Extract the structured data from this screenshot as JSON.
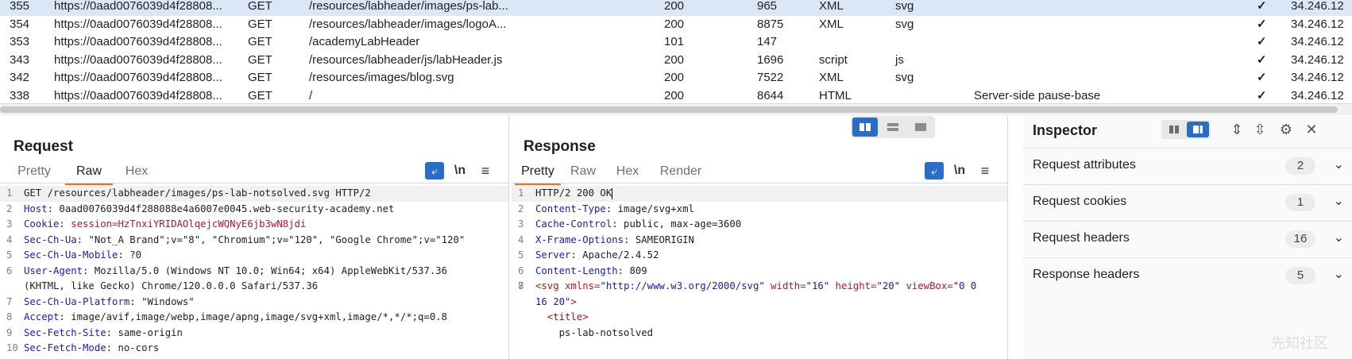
{
  "history": {
    "rows": [
      {
        "num": "355",
        "host": "https://0aad0076039d4f28808...",
        "method": "GET",
        "url": "/resources/labheader/images/ps-lab...",
        "status": "200",
        "length": "965",
        "mime": "XML",
        "ext": "svg",
        "title": "",
        "tls": "✓",
        "ip": "34.246.12",
        "selected": true
      },
      {
        "num": "354",
        "host": "https://0aad0076039d4f28808...",
        "method": "GET",
        "url": "/resources/labheader/images/logoA...",
        "status": "200",
        "length": "8875",
        "mime": "XML",
        "ext": "svg",
        "title": "",
        "tls": "✓",
        "ip": "34.246.12",
        "selected": false
      },
      {
        "num": "353",
        "host": "https://0aad0076039d4f28808...",
        "method": "GET",
        "url": "/academyLabHeader",
        "status": "101",
        "length": "147",
        "mime": "",
        "ext": "",
        "title": "",
        "tls": "✓",
        "ip": "34.246.12",
        "selected": false
      },
      {
        "num": "343",
        "host": "https://0aad0076039d4f28808...",
        "method": "GET",
        "url": "/resources/labheader/js/labHeader.js",
        "status": "200",
        "length": "1696",
        "mime": "script",
        "ext": "js",
        "title": "",
        "tls": "✓",
        "ip": "34.246.12",
        "selected": false
      },
      {
        "num": "342",
        "host": "https://0aad0076039d4f28808...",
        "method": "GET",
        "url": "/resources/images/blog.svg",
        "status": "200",
        "length": "7522",
        "mime": "XML",
        "ext": "svg",
        "title": "",
        "tls": "✓",
        "ip": "34.246.12",
        "selected": false
      },
      {
        "num": "338",
        "host": "https://0aad0076039d4f28808...",
        "method": "GET",
        "url": "/",
        "status": "200",
        "length": "8644",
        "mime": "HTML",
        "ext": "",
        "title": "Server-side pause-base",
        "tls": "✓",
        "ip": "34.246.12",
        "selected": false
      }
    ]
  },
  "request": {
    "title": "Request",
    "tabs": [
      "Pretty",
      "Raw",
      "Hex"
    ],
    "active_tab": "Raw",
    "ln_label": "\\n",
    "lines": [
      {
        "n": "1",
        "parts": [
          {
            "t": "GET /resources/labheader/images/ps-lab-notsolved.svg HTTP/2",
            "c": "txt"
          }
        ]
      },
      {
        "n": "2",
        "parts": [
          {
            "t": "Host",
            "c": "hk"
          },
          {
            "t": ": 0aad0076039d4f288088e4a6007e0045.web-security-academy.net",
            "c": "hv"
          }
        ]
      },
      {
        "n": "3",
        "parts": [
          {
            "t": "Cookie",
            "c": "hk"
          },
          {
            "t": ": ",
            "c": "hv"
          },
          {
            "t": "session=HzTnxiYRIDAOlqejcWQNyE6jb3wN8jdi",
            "c": "ck"
          }
        ]
      },
      {
        "n": "4",
        "parts": [
          {
            "t": "Sec-Ch-Ua",
            "c": "hk"
          },
          {
            "t": ": \"Not_A Brand\";v=\"8\", \"Chromium\";v=\"120\", \"Google Chrome\";v=\"120\"",
            "c": "hv"
          }
        ]
      },
      {
        "n": "5",
        "parts": [
          {
            "t": "Sec-Ch-Ua-Mobile",
            "c": "hk"
          },
          {
            "t": ": ?0",
            "c": "hv"
          }
        ]
      },
      {
        "n": "6",
        "parts": [
          {
            "t": "User-Agent",
            "c": "hk"
          },
          {
            "t": ": Mozilla/5.0 (Windows NT 10.0; Win64; x64) AppleWebKit/537.36",
            "c": "hv"
          }
        ]
      },
      {
        "n": "",
        "parts": [
          {
            "t": "(KHTML, like Gecko) Chrome/120.0.0.0 Safari/537.36",
            "c": "hv"
          }
        ]
      },
      {
        "n": "7",
        "parts": [
          {
            "t": "Sec-Ch-Ua-Platform",
            "c": "hk"
          },
          {
            "t": ": \"Windows\"",
            "c": "hv"
          }
        ]
      },
      {
        "n": "8",
        "parts": [
          {
            "t": "Accept",
            "c": "hk"
          },
          {
            "t": ": image/avif,image/webp,image/apng,image/svg+xml,image/*,*/*;q=0.8",
            "c": "hv"
          }
        ]
      },
      {
        "n": "9",
        "parts": [
          {
            "t": "Sec-Fetch-Site",
            "c": "hk"
          },
          {
            "t": ": same-origin",
            "c": "hv"
          }
        ]
      },
      {
        "n": "10",
        "parts": [
          {
            "t": "Sec-Fetch-Mode",
            "c": "hk"
          },
          {
            "t": ": no-cors",
            "c": "hv"
          }
        ]
      }
    ]
  },
  "response": {
    "title": "Response",
    "tabs": [
      "Pretty",
      "Raw",
      "Hex",
      "Render"
    ],
    "active_tab": "Pretty",
    "ln_label": "\\n",
    "lines": [
      {
        "n": "1",
        "parts": [
          {
            "t": "HTTP/2 200 OK",
            "c": "txt"
          }
        ],
        "cursor": true
      },
      {
        "n": "2",
        "parts": [
          {
            "t": "Content-Type",
            "c": "hk"
          },
          {
            "t": ": image/svg+xml",
            "c": "hv"
          }
        ]
      },
      {
        "n": "3",
        "parts": [
          {
            "t": "Cache-Control",
            "c": "hk"
          },
          {
            "t": ": public, max-age=3600",
            "c": "hv"
          }
        ]
      },
      {
        "n": "4",
        "parts": [
          {
            "t": "X-Frame-Options",
            "c": "hk"
          },
          {
            "t": ": SAMEORIGIN",
            "c": "hv"
          }
        ]
      },
      {
        "n": "5",
        "parts": [
          {
            "t": "Server",
            "c": "hk"
          },
          {
            "t": ": Apache/2.4.52",
            "c": "hv"
          }
        ]
      },
      {
        "n": "6",
        "parts": [
          {
            "t": "Content-Length",
            "c": "hk"
          },
          {
            "t": ": 809",
            "c": "hv"
          }
        ]
      },
      {
        "n": "7",
        "parts": [
          {
            "t": "",
            "c": "txt"
          }
        ]
      },
      {
        "n": "8",
        "parts": [
          {
            "t": "<svg ",
            "c": "tg"
          },
          {
            "t": "xmlns=",
            "c": "at"
          },
          {
            "t": "\"http://www.w3.org/2000/svg\"",
            "c": "av"
          },
          {
            "t": " width=",
            "c": "at"
          },
          {
            "t": "\"16\"",
            "c": "av"
          },
          {
            "t": " height=",
            "c": "at"
          },
          {
            "t": "\"20\"",
            "c": "av"
          },
          {
            "t": " viewBox=",
            "c": "at"
          },
          {
            "t": "\"0 0",
            "c": "av"
          }
        ]
      },
      {
        "n": "",
        "parts": [
          {
            "t": "16 20\"",
            "c": "av"
          },
          {
            "t": ">",
            "c": "tg"
          }
        ]
      },
      {
        "n": "",
        "parts": [
          {
            "t": "  <title>",
            "c": "tg"
          }
        ]
      },
      {
        "n": "",
        "parts": [
          {
            "t": "    ps-lab-notsolved",
            "c": "txt"
          }
        ]
      }
    ]
  },
  "inspector": {
    "title": "Inspector",
    "sections": [
      {
        "label": "Request attributes",
        "count": "2"
      },
      {
        "label": "Request cookies",
        "count": "1"
      },
      {
        "label": "Request headers",
        "count": "16"
      },
      {
        "label": "Response headers",
        "count": "5"
      }
    ]
  },
  "colors": {
    "accent": "#2b6cc4",
    "tab_underline": "#e8702a",
    "selected_row": "#dbe6f6",
    "header_key": "#1a1ab8",
    "cookie_value": "#c8102e"
  },
  "watermark": "先知社区"
}
